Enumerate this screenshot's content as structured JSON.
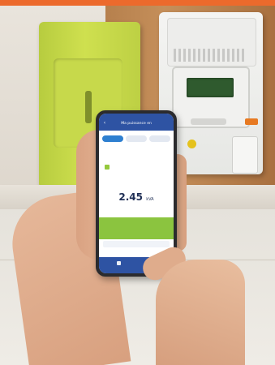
{
  "phone_app": {
    "header_title": "Ma puissance en",
    "back_icon": "back-arrow-icon",
    "tabs": [
      "",
      "",
      ""
    ],
    "reading_value": "2.45",
    "reading_unit": "kVA",
    "colors": {
      "header": "#2e53a3",
      "accent_green": "#8bc43f",
      "active_tab": "#2e7fd0"
    }
  },
  "scene": {
    "objects": [
      "green-meter-case",
      "electricity-meter",
      "smartphone",
      "hands"
    ],
    "accent_color": "#ec6a2c"
  }
}
